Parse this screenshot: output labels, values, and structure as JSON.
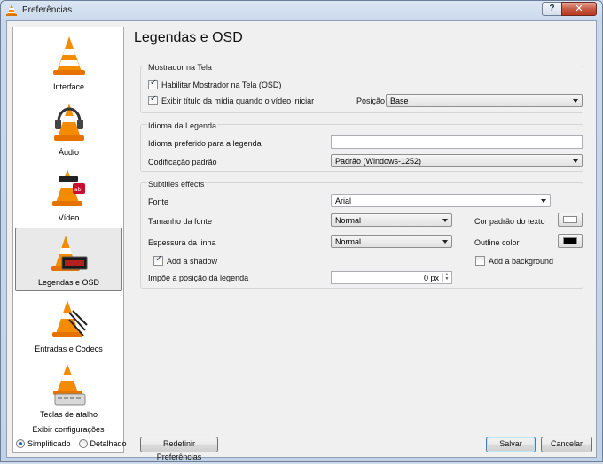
{
  "window": {
    "title": "Preferências",
    "help_glyph": "?",
    "close_glyph": "✕"
  },
  "sidebar": {
    "items": [
      {
        "label": "Interface",
        "icon": "vlc-cone-icon"
      },
      {
        "label": "Áudio",
        "icon": "headphones-cone-icon"
      },
      {
        "label": "Vídeo",
        "icon": "video-cone-icon"
      },
      {
        "label": "Legendas e OSD",
        "icon": "subtitles-cone-icon",
        "selected": true
      },
      {
        "label": "Entradas e Codecs",
        "icon": "input-codecs-cone-icon"
      },
      {
        "label": "Teclas de atalho",
        "icon": "hotkeys-cone-icon"
      }
    ],
    "show_settings_label": "Exibir configurações",
    "simple_label": "Simplificado",
    "detailed_label": "Detalhado",
    "mode": "simple"
  },
  "page": {
    "title": "Legendas e OSD",
    "osd": {
      "title": "Mostrador na Tela",
      "enable_osd_label": "Habilitar Mostrador na Tela (OSD)",
      "enable_osd": true,
      "show_title_label": "Exibir título da mídia quando o vídeo iniciar",
      "show_title": true,
      "position_label": "Posição",
      "position_value": "Base"
    },
    "language": {
      "title": "Idioma da Legenda",
      "preferred_label": "Idioma preferido para a legenda",
      "preferred_value": "",
      "encoding_label": "Codificação padrão",
      "encoding_value": "Padrão (Windows-1252)"
    },
    "effects": {
      "title": "Subtitles effects",
      "font_label": "Fonte",
      "font_value": "Arial",
      "font_size_label": "Tamanho da fonte",
      "font_size_value": "Normal",
      "text_color_label": "Cor padrão do texto",
      "text_color": "#ffffff",
      "outline_label": "Espessura da linha",
      "outline_value": "Normal",
      "outline_color_label": "Outline color",
      "outline_color": "#000000",
      "shadow_label": "Add a shadow",
      "shadow": true,
      "background_label": "Add a background",
      "background": false,
      "force_position_label": "Impõe a posição da legenda",
      "force_position_value": "0 px"
    }
  },
  "footer": {
    "reset_label": "Redefinir Preferências",
    "save_label": "Salvar",
    "cancel_label": "Cancelar"
  }
}
